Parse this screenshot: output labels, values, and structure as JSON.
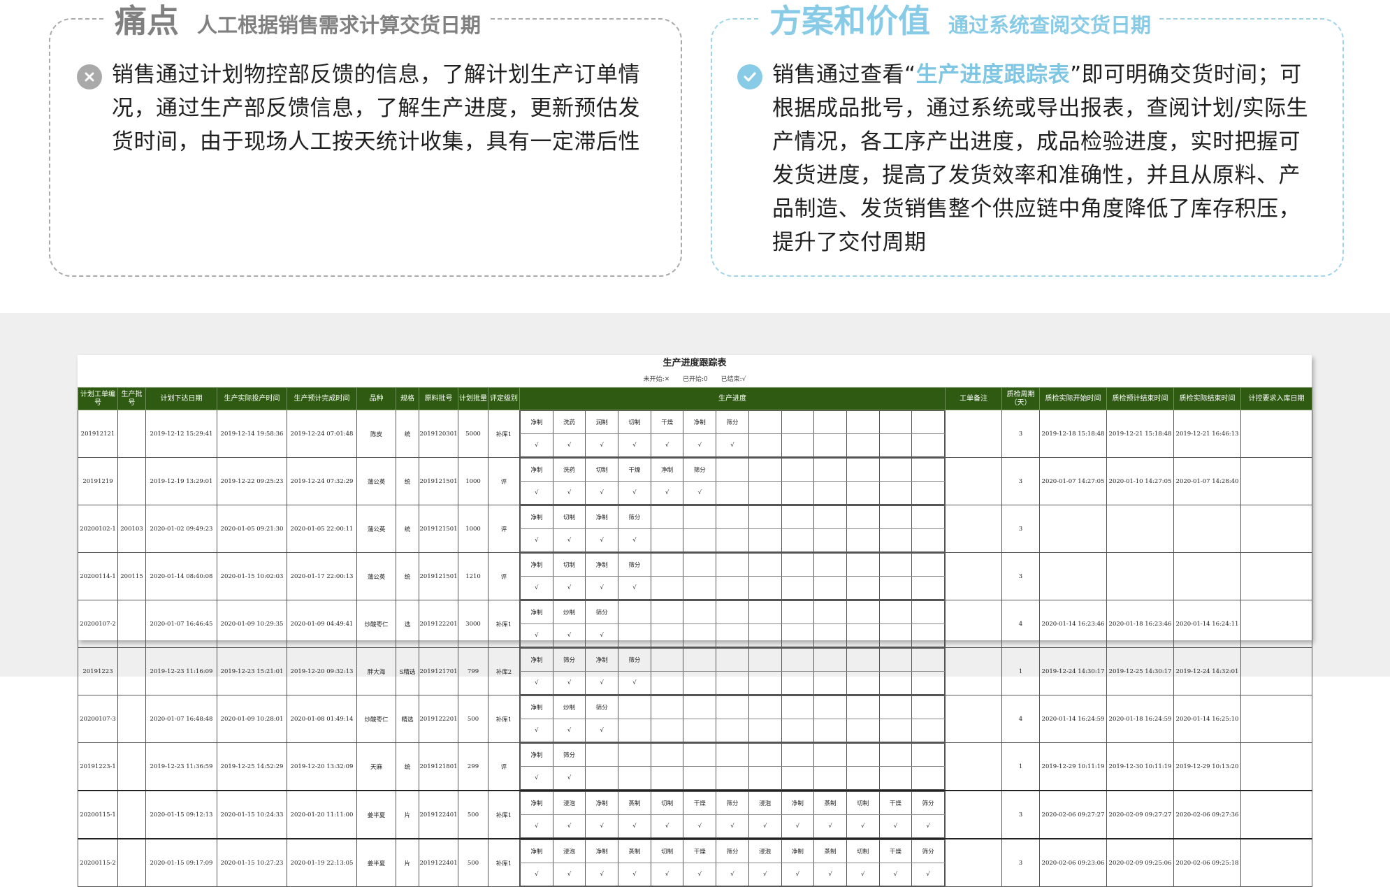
{
  "pain": {
    "title": "痛点",
    "subtitle": "人工根据销售需求计算交货日期",
    "icon": "close-circle-icon",
    "text": "销售通过计划物控部反馈的信息，了解计划生产订单情况，通过生产部反馈信息，了解生产进度，更新预估发货时间，由于现场人工按天统计收集，具有一定滞后性"
  },
  "value": {
    "title": "方案和价值",
    "subtitle": "通过系统查阅交货日期",
    "icon": "check-circle-icon",
    "text_before": "销售通过查看“",
    "highlight": "生产进度跟踪表",
    "text_after": "”即可明确交货时间；可根据成品批号，通过系统或导出报表，查阅计划/实际生产情况，各工序产出进度，成品检验进度，实时把握可发货进度，提高了发货效率和准确性，并且从原料、产品制造、发货销售整个供应链中角度降低了库存积压，提升了交付周期"
  },
  "colors": {
    "pain_gray": "#a9a9a9",
    "value_blue": "#87cbe6",
    "table_header": "#2e5b11"
  },
  "sheet": {
    "title": "生产进度跟踪表",
    "legend": [
      "未开始:✕",
      "已开始:0",
      "已结束:√"
    ],
    "headers": [
      "计划工单编号",
      "生产批号",
      "计划下达日期",
      "生产实际投产时间",
      "生产预计完成时间",
      "品种",
      "规格",
      "原料批号",
      "计划批量",
      "评定级别",
      "生产进度",
      "工单备注",
      "质检周期（天）",
      "质检实际开始时间",
      "质检预计结束时间",
      "质检实际结束时间",
      "计控要求入库日期"
    ],
    "rows": [
      {
        "order": "201912121",
        "batch": "",
        "issue": "2019-12-12 15:29:41",
        "start": "2019-12-14 19:58:36",
        "finish": "2019-12-24 07:01:48",
        "variety": "陈皮",
        "spec": "统",
        "raw": "2019120301",
        "qty": "5000",
        "grade": "补库1",
        "steps": [
          "净制",
          "洗药",
          "润制",
          "切制",
          "干燥",
          "净制",
          "筛分"
        ],
        "marks": [
          "√",
          "√",
          "√",
          "√",
          "√",
          "√",
          "√"
        ],
        "remark": "",
        "cycle": "3",
        "qc_start": "2019-12-18 15:18:48",
        "qc_plan_end": "2019-12-21 15:18:48",
        "qc_end": "2019-12-21 16:46:13",
        "due": ""
      },
      {
        "order": "20191219",
        "batch": "",
        "issue": "2019-12-19 13:29:01",
        "start": "2019-12-22 09:25:23",
        "finish": "2019-12-24 07:32:29",
        "variety": "蒲公英",
        "spec": "统",
        "raw": "2019121501",
        "qty": "1000",
        "grade": "评",
        "steps": [
          "净制",
          "洗药",
          "切制",
          "干燥",
          "净制",
          "筛分"
        ],
        "marks": [
          "√",
          "√",
          "√",
          "√",
          "√",
          "√"
        ],
        "remark": "",
        "cycle": "3",
        "qc_start": "2020-01-07 14:27:05",
        "qc_plan_end": "2020-01-10 14:27:05",
        "qc_end": "2020-01-07 14:28:40",
        "due": ""
      },
      {
        "order": "20200102-1",
        "batch": "200103",
        "issue": "2020-01-02 09:49:23",
        "start": "2020-01-05 09:21:30",
        "finish": "2020-01-05 22:00:11",
        "variety": "蒲公英",
        "spec": "统",
        "raw": "2019121501",
        "qty": "1000",
        "grade": "评",
        "steps": [
          "净制",
          "切制",
          "净制",
          "筛分"
        ],
        "marks": [
          "√",
          "√",
          "√",
          "√"
        ],
        "remark": "",
        "cycle": "3",
        "qc_start": "",
        "qc_plan_end": "",
        "qc_end": "",
        "due": ""
      },
      {
        "order": "20200114-1",
        "batch": "200115",
        "issue": "2020-01-14 08:40:08",
        "start": "2020-01-15 10:02:03",
        "finish": "2020-01-17 22:00:13",
        "variety": "蒲公英",
        "spec": "统",
        "raw": "2019121501",
        "qty": "1210",
        "grade": "评",
        "steps": [
          "净制",
          "切制",
          "净制",
          "筛分"
        ],
        "marks": [
          "√",
          "√",
          "√",
          "√"
        ],
        "remark": "",
        "cycle": "3",
        "qc_start": "",
        "qc_plan_end": "",
        "qc_end": "",
        "due": ""
      },
      {
        "order": "20200107-2",
        "batch": "",
        "issue": "2020-01-07 16:46:45",
        "start": "2020-01-09 10:29:35",
        "finish": "2020-01-09 04:49:41",
        "variety": "炒酸枣仁",
        "spec": "选",
        "raw": "2019122201",
        "qty": "3000",
        "grade": "补库1",
        "steps": [
          "净制",
          "炒制",
          "筛分"
        ],
        "marks": [
          "√",
          "√",
          "√"
        ],
        "remark": "",
        "cycle": "4",
        "qc_start": "2020-01-14 16:23:46",
        "qc_plan_end": "2020-01-18 16:23:46",
        "qc_end": "2020-01-14 16:24:11",
        "due": ""
      },
      {
        "order": "20191223",
        "batch": "",
        "issue": "2019-12-23 11:16:09",
        "start": "2019-12-23 15:21:01",
        "finish": "2019-12-20 09:32:13",
        "variety": "胖大海",
        "spec": "S精选",
        "raw": "2019121701",
        "qty": "799",
        "grade": "补库2",
        "steps": [
          "净制",
          "筛分",
          "净制",
          "筛分"
        ],
        "marks": [
          "√",
          "√",
          "√",
          "√"
        ],
        "remark": "",
        "cycle": "1",
        "qc_start": "2019-12-24 14:30:17",
        "qc_plan_end": "2019-12-25 14:30:17",
        "qc_end": "2019-12-24 14:32:01",
        "due": ""
      },
      {
        "order": "20200107-3",
        "batch": "",
        "issue": "2020-01-07 16:48:48",
        "start": "2020-01-09 10:28:01",
        "finish": "2020-01-08 01:49:14",
        "variety": "炒酸枣仁",
        "spec": "精选",
        "raw": "2019122201",
        "qty": "500",
        "grade": "补库1",
        "steps": [
          "净制",
          "炒制",
          "筛分"
        ],
        "marks": [
          "√",
          "√",
          "√"
        ],
        "remark": "",
        "cycle": "4",
        "qc_start": "2020-01-14 16:24:59",
        "qc_plan_end": "2020-01-18 16:24:59",
        "qc_end": "2020-01-14 16:25:10",
        "due": ""
      },
      {
        "order": "20191223-1",
        "batch": "",
        "issue": "2019-12-23 11:36:59",
        "start": "2019-12-25 14:52:29",
        "finish": "2019-12-20 13:32:09",
        "variety": "天麻",
        "spec": "统",
        "raw": "2019121801",
        "qty": "299",
        "grade": "评",
        "steps": [
          "净制",
          "筛分"
        ],
        "marks": [
          "√",
          "√"
        ],
        "remark": "",
        "cycle": "1",
        "qc_start": "2019-12-29 10:11:19",
        "qc_plan_end": "2019-12-30 10:11:19",
        "qc_end": "2019-12-29 10:13:20",
        "due": ""
      },
      {
        "order": "20200115-1",
        "batch": "",
        "issue": "2020-01-15 09:12:13",
        "start": "2020-01-15 10:24:33",
        "finish": "2020-01-20 11:11:00",
        "variety": "姜半夏",
        "spec": "片",
        "raw": "2019122401",
        "qty": "500",
        "grade": "补库1",
        "steps": [
          "净制",
          "浸泡",
          "净制",
          "蒸制",
          "切制",
          "干燥",
          "筛分",
          "浸泡",
          "净制",
          "蒸制",
          "切制",
          "干燥",
          "筛分"
        ],
        "marks": [
          "√",
          "√",
          "√",
          "√",
          "√",
          "√",
          "√",
          "√",
          "√",
          "√",
          "√",
          "√",
          "√"
        ],
        "remark": "",
        "cycle": "3",
        "qc_start": "2020-02-06 09:27:27",
        "qc_plan_end": "2020-02-09 09:27:27",
        "qc_end": "2020-02-06 09:27:36",
        "due": ""
      },
      {
        "order": "20200115-2",
        "batch": "",
        "issue": "2020-01-15 09:17:09",
        "start": "2020-01-15 10:27:23",
        "finish": "2020-01-19 22:13:05",
        "variety": "姜半夏",
        "spec": "片",
        "raw": "2019122401",
        "qty": "500",
        "grade": "补库1",
        "steps": [
          "净制",
          "浸泡",
          "净制",
          "蒸制",
          "切制",
          "干燥",
          "筛分",
          "浸泡",
          "净制",
          "蒸制",
          "切制",
          "干燥",
          "筛分"
        ],
        "marks": [
          "√",
          "√",
          "√",
          "√",
          "√",
          "√",
          "√",
          "√",
          "√",
          "√",
          "√",
          "√",
          "√"
        ],
        "remark": "",
        "cycle": "3",
        "qc_start": "2020-02-06 09:23:06",
        "qc_plan_end": "2020-02-09 09:25:06",
        "qc_end": "2020-02-06 09:25:18",
        "due": ""
      }
    ]
  }
}
